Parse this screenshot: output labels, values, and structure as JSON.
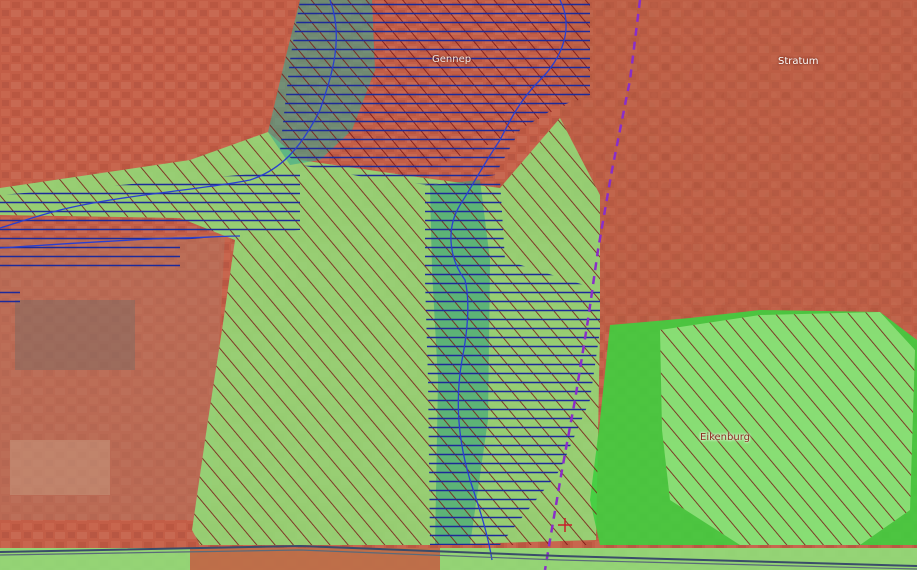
{
  "map": {
    "labels": {
      "gennep": "Gennep",
      "stratum": "Stratum",
      "eikenburg": "Eikenburg"
    },
    "colors": {
      "urban_zone": "#c8553e",
      "nature_zone": "#8fe07a",
      "forest_zone": "#3fcf3f",
      "wet_zone": "#2e9e7a",
      "hatch_red": "#8a1a1a",
      "hatch_blue": "#1a2a9a",
      "boundary_purple": "#8a2ec8",
      "river_line": "#2a3fd0"
    }
  }
}
